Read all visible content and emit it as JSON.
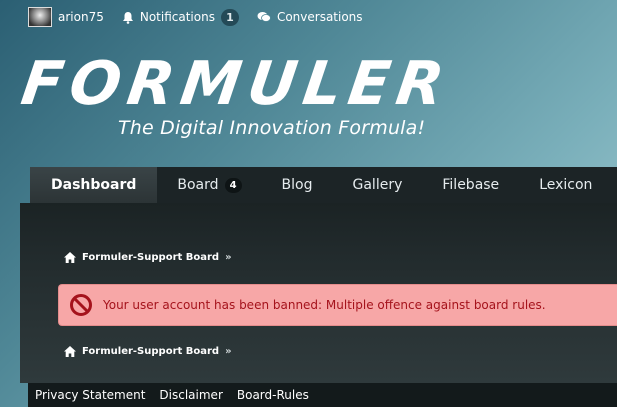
{
  "userbar": {
    "username": "arion75",
    "notifications_label": "Notifications",
    "notifications_count": "1",
    "conversations_label": "Conversations"
  },
  "header": {
    "logo_text": "FORMULER",
    "tagline": "The Digital Innovation Formula!"
  },
  "nav": {
    "tabs": [
      {
        "label": "Dashboard",
        "active": true
      },
      {
        "label": "Board",
        "badge": "4"
      },
      {
        "label": "Blog"
      },
      {
        "label": "Gallery"
      },
      {
        "label": "Filebase"
      },
      {
        "label": "Lexicon"
      }
    ]
  },
  "main": {
    "breadcrumb": "Formuler-Support Board",
    "breadcrumb_sep": "»",
    "error_message": "Your user account has been banned: Multiple offence against board rules.",
    "error_color": "#f7a7a7",
    "error_text_color": "#a5131c"
  },
  "footer": {
    "links": [
      "Privacy Statement",
      "Disclaimer",
      "Board-Rules"
    ]
  },
  "icons": {
    "home": "home-icon",
    "bell": "bell-icon",
    "chat": "conversations-icon",
    "ban": "ban-icon"
  }
}
